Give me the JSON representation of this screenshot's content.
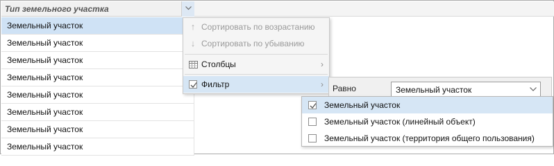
{
  "grid": {
    "column_title": "Тип земельного участка",
    "rows": [
      "Земельный участок",
      "Земельный участок",
      "Земельный участок",
      "Земельный участок",
      "Земельный участок",
      "Земельный участок",
      "Земельный участок",
      "Земельный участок"
    ]
  },
  "menu": {
    "sort_asc": "Сортировать по возрастанию",
    "sort_desc": "Сортировать по убыванию",
    "columns": "Столбцы",
    "filter": "Фильтр"
  },
  "filter": {
    "operator_label": "Равно",
    "selected_value": "Земельный участок",
    "options": [
      {
        "label": "Земельный участок",
        "checked": true
      },
      {
        "label": "Земельный участок (линейный объект)",
        "checked": false
      },
      {
        "label": "Земельный участок (территория общего пользования)",
        "checked": false
      }
    ]
  },
  "colors": {
    "selected_row": "#cfe2f5",
    "menu_highlight": "#d6e6f5",
    "header_bg": "#f1f1f1"
  }
}
